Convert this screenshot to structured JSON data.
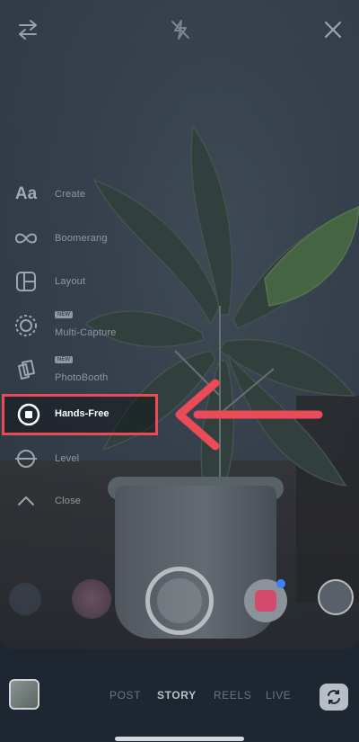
{
  "top_bar": {
    "switch_icon": "swap-arrows-icon",
    "flash_icon": "flash-off-icon",
    "close_icon": "close-icon"
  },
  "tools": {
    "items": [
      {
        "label": "Create",
        "icon": "text-aa-icon"
      },
      {
        "label": "Boomerang",
        "icon": "infinity-icon"
      },
      {
        "label": "Layout",
        "icon": "layout-grid-icon"
      },
      {
        "label": "Multi-Capture",
        "icon": "multi-capture-icon",
        "tag": "NEW"
      },
      {
        "label": "PhotoBooth",
        "icon": "photobooth-icon",
        "tag": "NEW"
      },
      {
        "label": "Hands-Free",
        "icon": "hands-free-icon",
        "highlighted": true
      },
      {
        "label": "Level",
        "icon": "level-icon"
      },
      {
        "label": "Close",
        "icon": "chevron-up-icon"
      }
    ]
  },
  "annotation": {
    "color": "#ea4b57"
  },
  "modes": {
    "items": [
      "POST",
      "STORY",
      "REELS",
      "LIVE"
    ],
    "active": "STORY"
  },
  "colors": {
    "accent": "#ea4b57",
    "background": "#1d2631",
    "active_mode": "#b9c0c7"
  }
}
